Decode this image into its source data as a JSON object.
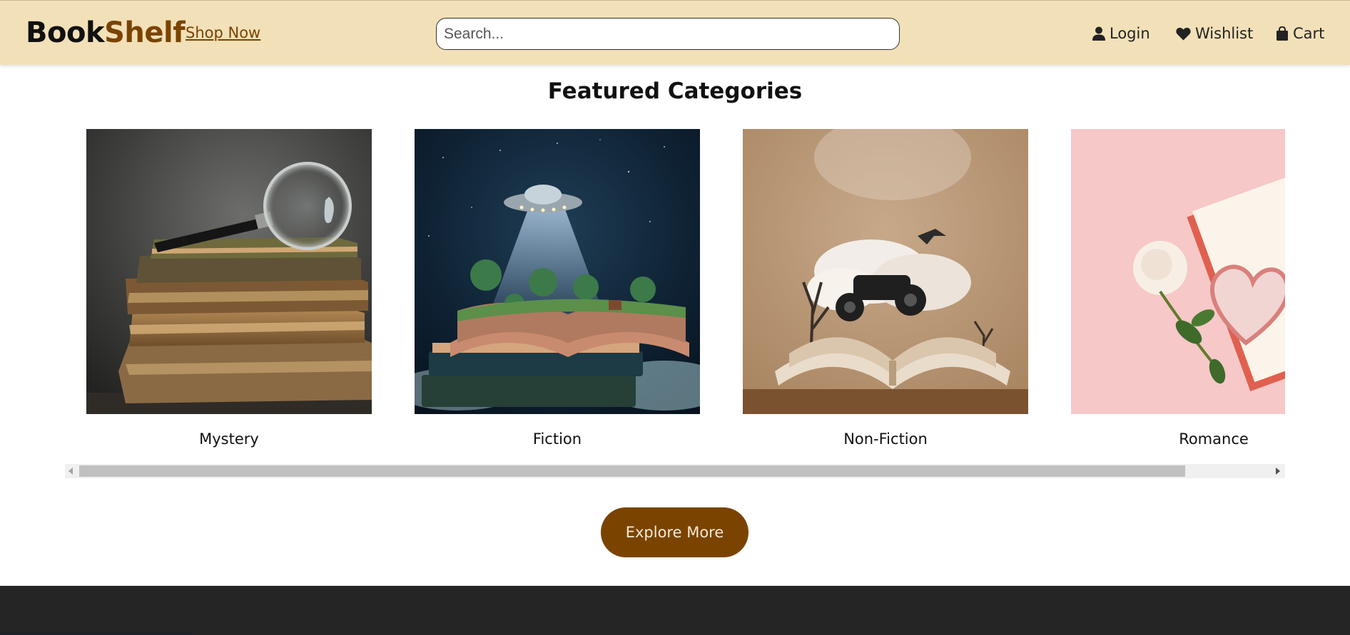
{
  "header": {
    "brand_part1": "Book",
    "brand_part2": "Shelf",
    "shop_link": "Shop Now",
    "search_placeholder": "Search...",
    "nav": {
      "login": "Login",
      "wishlist": "Wishlist",
      "cart": "Cart"
    }
  },
  "featured": {
    "title": "Featured Categories",
    "categories": [
      {
        "label": "Mystery",
        "icon": "magnifier-books-image"
      },
      {
        "label": "Fiction",
        "icon": "ufo-book-image"
      },
      {
        "label": "Non-Fiction",
        "icon": "atv-book-image"
      },
      {
        "label": "Romance",
        "icon": "rose-heart-image"
      }
    ],
    "button": "Explore More"
  },
  "colors": {
    "header_bg": "#f2e0b8",
    "brand_accent": "#7a4300",
    "button_bg": "#7a4300",
    "footer_bg": "#252525"
  }
}
